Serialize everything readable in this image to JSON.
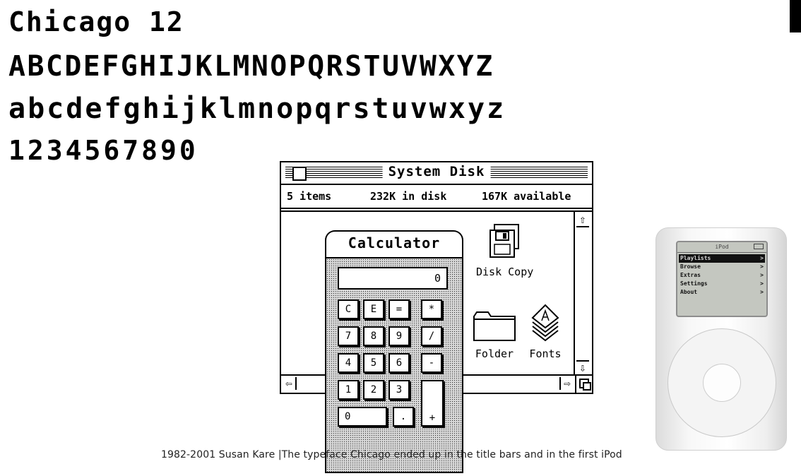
{
  "specimen": {
    "line1": "Chicago 12",
    "line2": "ABCDEFGHIJKLMNOPQRSTUVWXYZ",
    "line3": "abcdefghijklmnopqrstuvwxyz",
    "line4": "1234567890"
  },
  "finder": {
    "title": "System Disk",
    "items": "5 items",
    "in_disk": "232K in disk",
    "available": "167K available",
    "icons": [
      {
        "label": "Disk Copy",
        "icon": "disk-copy-icon"
      },
      {
        "label": "Folder",
        "icon": "folder-icon"
      },
      {
        "label": "Fonts",
        "icon": "fonts-icon"
      }
    ]
  },
  "calculator": {
    "title": "Calculator",
    "display": "0",
    "keys": [
      "C",
      "E",
      "=",
      "*",
      "7",
      "8",
      "9",
      "/",
      "4",
      "5",
      "6",
      "-",
      "1",
      "2",
      "3",
      "+",
      "0",
      "."
    ]
  },
  "ipod": {
    "header": "iPod",
    "menu": [
      {
        "label": "Playlists",
        "selected": true
      },
      {
        "label": "Browse",
        "selected": false
      },
      {
        "label": "Extras",
        "selected": false
      },
      {
        "label": "Settings",
        "selected": false
      },
      {
        "label": "About",
        "selected": false
      }
    ]
  },
  "caption": "1982-2001 Susan Kare |The typeface Chicago ended up in the title bars and in the first iPod"
}
